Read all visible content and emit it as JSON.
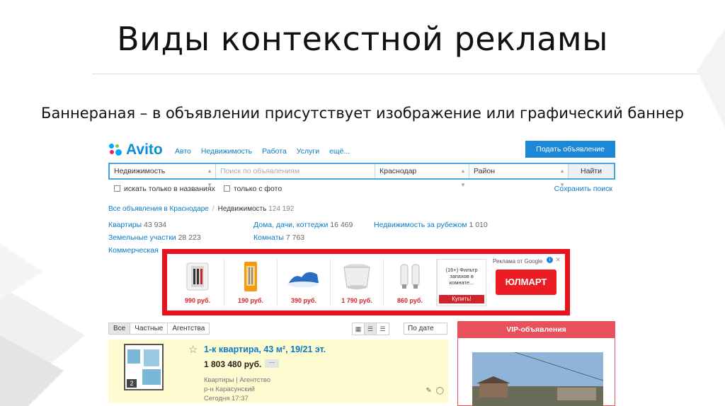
{
  "slide": {
    "title": "Виды контекстной рекламы",
    "subtitle": "Баннераная – в объявлении присутствует изображение или графический баннер"
  },
  "colors": {
    "avito_blue": "#0a8ed6",
    "link_blue": "#0a7bc4",
    "banner_border": "#e8121f",
    "price_red": "#d2232a",
    "vip_red": "#e8505b",
    "highlight_yellow": "#fefbd1",
    "ulmart_red": "#ec1c24"
  },
  "header": {
    "logo": "Avito",
    "nav": [
      "Авто",
      "Недвижимость",
      "Работа",
      "Услуги",
      "ещё..."
    ],
    "post_button": "Подать объявление"
  },
  "search": {
    "category": "Недвижимость",
    "query_placeholder": "Поиск по объявлениям",
    "city": "Краснодар",
    "area": "Район",
    "submit": "Найти",
    "only_titles": "искать только в названиях",
    "only_photo": "только с фото",
    "only_titles_checked": false,
    "only_photo_checked": false,
    "saved_search": "Сохранить поиск"
  },
  "breadcrumb": {
    "root": "Все объявления в Краснодаре",
    "current": "Недвижимость",
    "count": "124 192"
  },
  "categories": [
    {
      "label": "Квартиры",
      "count": "43 934"
    },
    {
      "label": "Дома, дачи, коттеджи",
      "count": "16 469"
    },
    {
      "label": "Недвижимость за рубежом",
      "count": "1 010"
    },
    {
      "label": "Земельные участки",
      "count": "28 223"
    },
    {
      "label": "Комнаты",
      "count": "7 763"
    },
    {
      "label": "Коммерческая",
      "count": ""
    }
  ],
  "banner": {
    "products": [
      {
        "price": "990 руб.",
        "icon": "knife-set-icon"
      },
      {
        "price": "190 руб.",
        "icon": "tools-pack-icon"
      },
      {
        "price": "390 руб.",
        "icon": "foam-pillow-icon"
      },
      {
        "price": "1 790 руб.",
        "icon": "steamer-icon"
      },
      {
        "price": "860 руб.",
        "icon": "led-bulbs-icon"
      }
    ],
    "ad_text": "(16+) Фильтр запахов в комнате...",
    "buy": "Купить!",
    "google_label": "Реклама от Google",
    "advertiser": "ЮЛМАРТ"
  },
  "listing_controls": {
    "filters": [
      "Все",
      "Частные",
      "Агентства"
    ],
    "active_filter": "Все",
    "view_modes": [
      "grid-view-icon",
      "list-view-icon",
      "table-view-icon"
    ],
    "sort": "По дате"
  },
  "listing": {
    "title": "1-к квартира, 43 м², 19/21 эт.",
    "price": "1 803 480 руб.",
    "more": "···",
    "type": "Квартиры | Агентство",
    "district": "р-н Карасунский",
    "date": "Сегодня 17:37",
    "rooms": "2"
  },
  "vip": {
    "title": "VIP-объявления"
  }
}
